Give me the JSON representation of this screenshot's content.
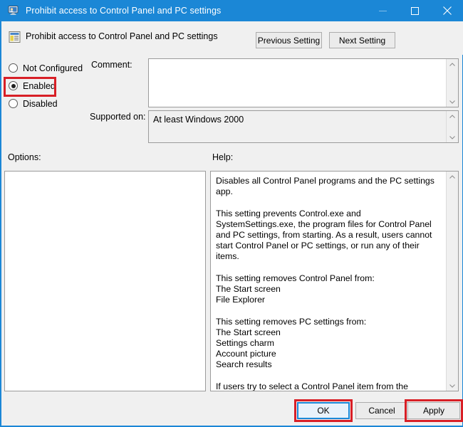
{
  "window": {
    "title": "Prohibit access to Control Panel and PC settings",
    "title_icon": "computer-monitor-icon",
    "controls": {
      "minimize": "minimize-icon",
      "maximize": "maximize-icon",
      "close": "close-icon"
    }
  },
  "header": {
    "setting_icon": "policy-setting-icon",
    "setting_name": "Prohibit access to Control Panel and PC settings",
    "previous_setting": "Previous Setting",
    "next_setting": "Next Setting"
  },
  "state_options": [
    {
      "label": "Not Configured",
      "selected": false
    },
    {
      "label": "Enabled",
      "selected": true
    },
    {
      "label": "Disabled",
      "selected": false
    }
  ],
  "comment": {
    "label": "Comment:",
    "value": "",
    "scroll_up": "▲",
    "scroll_down": "▼"
  },
  "supported_on": {
    "label": "Supported on:",
    "value": "At least Windows 2000",
    "scroll_up": "▲",
    "scroll_down": "▼"
  },
  "options": {
    "label": "Options:",
    "value": ""
  },
  "help": {
    "label": "Help:",
    "text": "Disables all Control Panel programs and the PC settings app.\n\nThis setting prevents Control.exe and SystemSettings.exe, the program files for Control Panel and PC settings, from starting. As a result, users cannot start Control Panel or PC settings, or run any of their items.\n\nThis setting removes Control Panel from:\nThe Start screen\nFile Explorer\n\nThis setting removes PC settings from:\nThe Start screen\nSettings charm\nAccount picture\nSearch results\n\nIf users try to select a Control Panel item from the Properties item on a context menu, a message appears explaining that a setting prevents the action.",
    "scroll_up": "▲",
    "scroll_down": "▼"
  },
  "buttons": {
    "ok": "OK",
    "cancel": "Cancel",
    "apply": "Apply"
  },
  "annotations": [
    {
      "name": "enabled-highlight",
      "color": "#d81f26"
    },
    {
      "name": "ok-highlight",
      "color": "#d81f26"
    },
    {
      "name": "apply-highlight",
      "color": "#d81f26"
    }
  ],
  "colors": {
    "titlebar": "#1b87d6",
    "dialog_bg": "#f0f0f0",
    "annotation": "#d81f26",
    "focus": "#1b87d6"
  }
}
